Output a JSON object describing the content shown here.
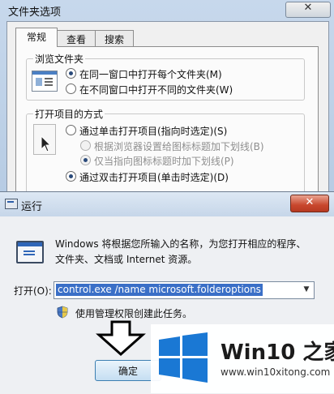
{
  "folder_options": {
    "title": "文件夹选项",
    "close_glyph": "✕",
    "tabs": [
      "常规",
      "查看",
      "搜索"
    ],
    "browse_group": {
      "label": "浏览文件夹",
      "options": [
        "在同一窗口中打开每个文件夹(M)",
        "在不同窗口中打开不同的文件夹(W)"
      ],
      "selected": 0
    },
    "click_group": {
      "label": "打开项目的方式",
      "options": [
        "通过单击打开项目(指向时选定)(S)",
        "根据浏览器设置给图标标题加下划线(B)",
        "仅当指向图标标题时加下划线(P)",
        "通过双击打开项目(单击时选定)(D)"
      ],
      "selected": 3
    }
  },
  "run_dialog": {
    "title": "运行",
    "close_glyph": "✕",
    "description": "Windows 将根据您所输入的名称，为您打开相应的程序、文件夹、文档或 Internet 资源。",
    "open_label": "打开(O):",
    "command_value": "control.exe /name microsoft.folderoptions",
    "admin_note": "使用管理权限创建此任务。",
    "ok_label": "确定"
  },
  "watermark": {
    "brand": "Win10 之家",
    "url": "www.win10xitong.com"
  },
  "colors": {
    "accent_blue": "#3a6fc7",
    "win_logo_blue": "#1a78d4"
  },
  "icons": [
    "shield-icon",
    "down-arrow-icon",
    "windows-logo-icon"
  ]
}
